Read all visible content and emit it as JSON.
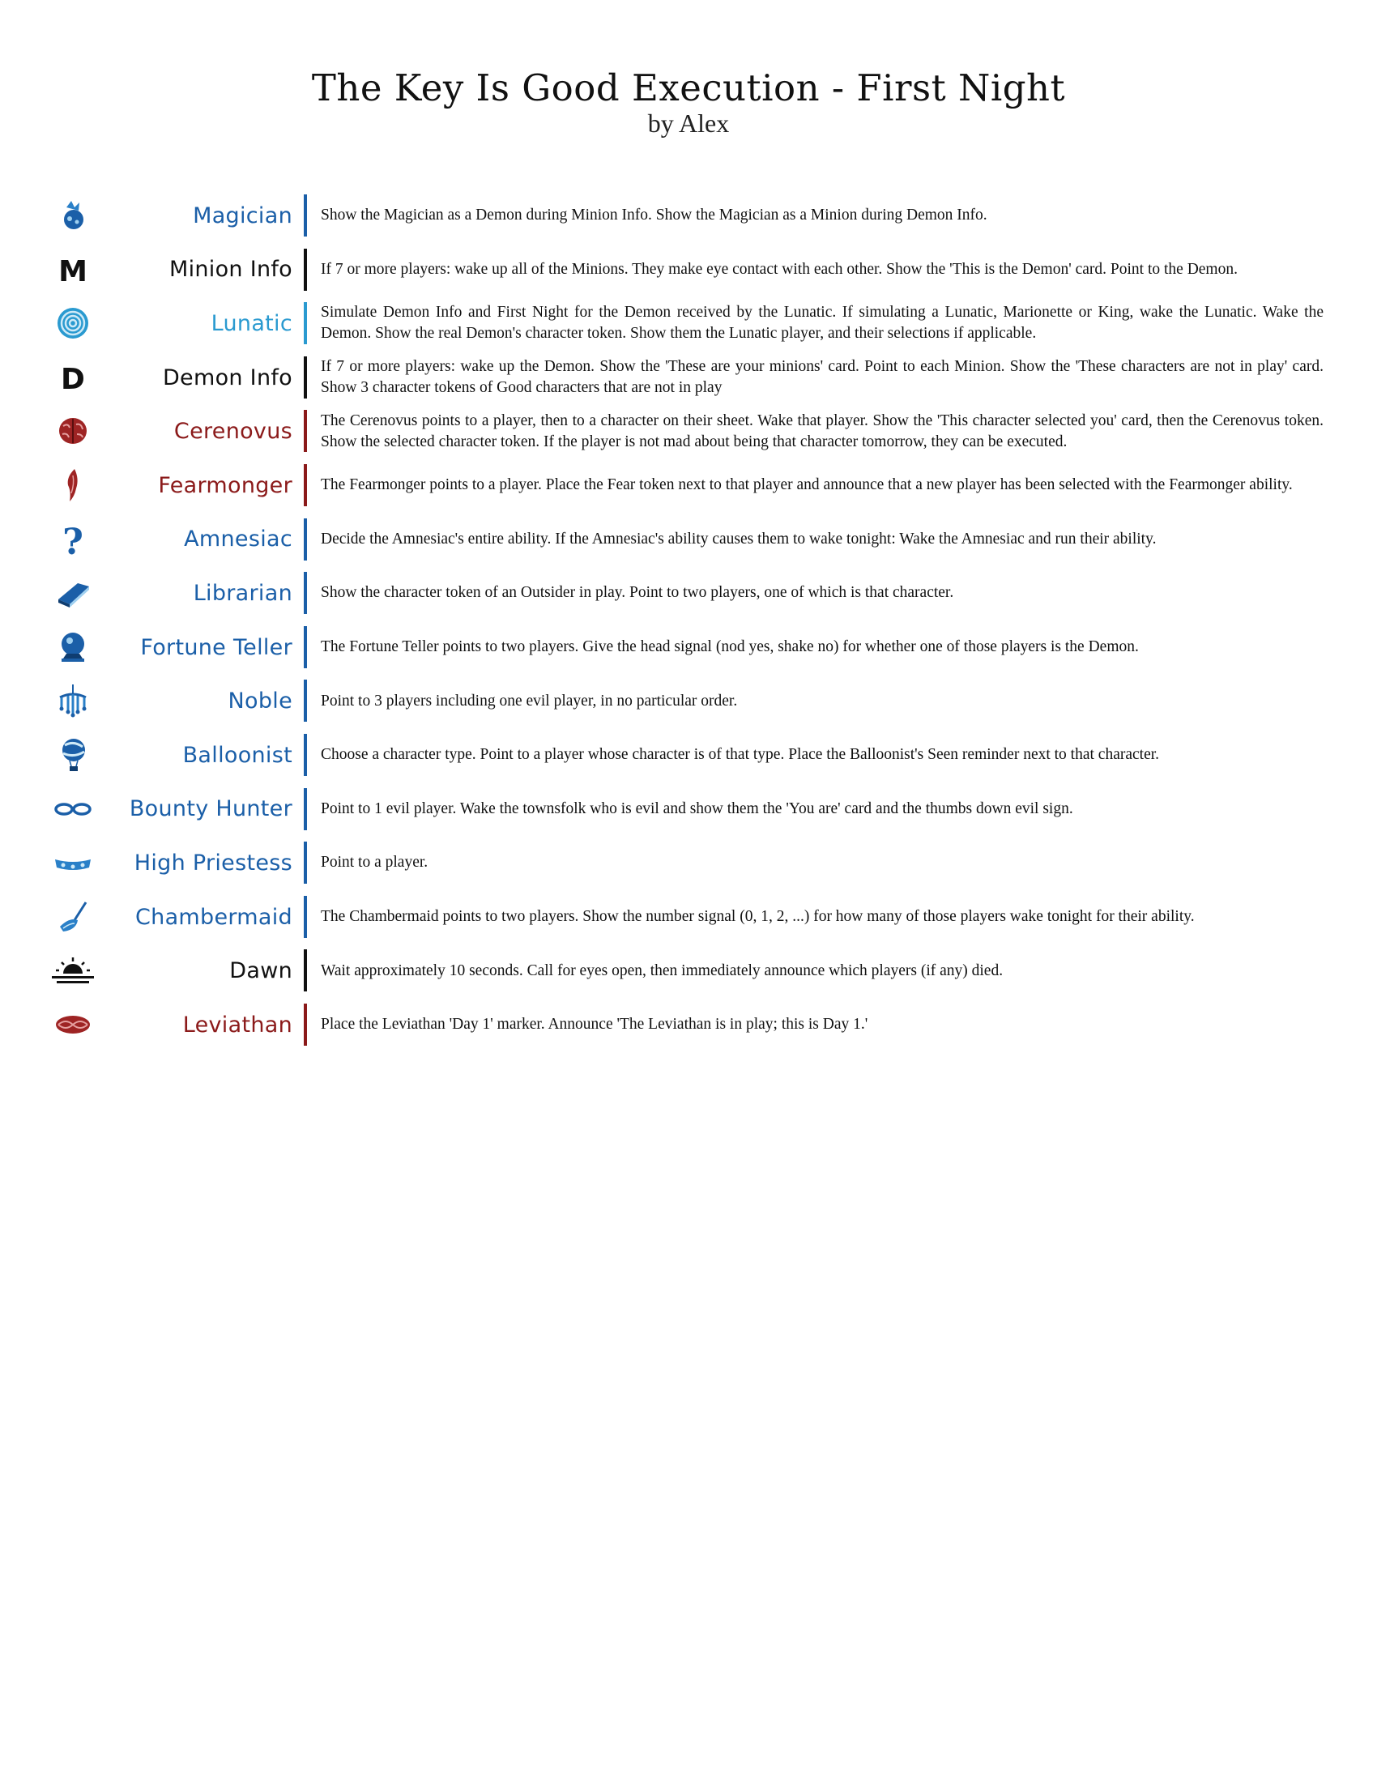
{
  "header": {
    "title": "The Key Is Good Execution - First Night",
    "subtitle": "by Alex"
  },
  "rows": [
    {
      "name": "Magician",
      "icon": "magician-icon",
      "team": "townsfolk",
      "text": "Show the Magician as a Demon during Minion Info. Show the Magician as a Minion during Demon Info."
    },
    {
      "name": "Minion Info",
      "icon": "minion-info-icon",
      "team": "info",
      "glyph": "M",
      "text": "If 7 or more players: wake up all of the Minions. They make eye contact with each other. Show the 'This is the Demon' card. Point to the Demon."
    },
    {
      "name": "Lunatic",
      "icon": "lunatic-icon",
      "team": "outsider",
      "text": "Simulate Demon Info and First Night for the Demon received by the Lunatic. If simulating a Lunatic, Marionette or King, wake the Lunatic. Wake the Demon. Show the real Demon's character token. Show them the Lunatic player, and their selections if applicable."
    },
    {
      "name": "Demon Info",
      "icon": "demon-info-icon",
      "team": "info",
      "glyph": "D",
      "text": "If 7 or more players: wake up the Demon. Show the 'These are your minions' card. Point to each Minion. Show the 'These characters are not in play' card. Show 3 character tokens of Good characters that are not in play"
    },
    {
      "name": "Cerenovus",
      "icon": "cerenovus-icon",
      "team": "minion",
      "text": "The Cerenovus points to a player, then to a character on their sheet. Wake that player. Show the 'This character selected you' card, then the Cerenovus token. Show the selected character token. If the player is not mad about being that character tomorrow, they can be executed."
    },
    {
      "name": "Fearmonger",
      "icon": "fearmonger-icon",
      "team": "minion",
      "text": "The Fearmonger points to a player. Place the Fear token next to that player and announce that a new player has been selected with the Fearmonger ability."
    },
    {
      "name": "Amnesiac",
      "icon": "amnesiac-icon",
      "team": "townsfolk",
      "text": "Decide the Amnesiac's entire ability. If the Amnesiac's ability causes them to wake tonight: Wake the Amnesiac and run their ability."
    },
    {
      "name": "Librarian",
      "icon": "librarian-icon",
      "team": "townsfolk",
      "text": "Show the character token of an Outsider in play. Point to two players, one of which is that character."
    },
    {
      "name": "Fortune Teller",
      "icon": "fortune-teller-icon",
      "team": "townsfolk",
      "text": "The Fortune Teller points to two players. Give the head signal (nod yes, shake no) for whether one of those players is the Demon."
    },
    {
      "name": "Noble",
      "icon": "noble-icon",
      "team": "townsfolk",
      "text": "Point to 3 players including one evil player, in no particular order."
    },
    {
      "name": "Balloonist",
      "icon": "balloonist-icon",
      "team": "townsfolk",
      "text": "Choose a character type. Point to a player whose character is of that type. Place the Balloonist's Seen reminder next to that character."
    },
    {
      "name": "Bounty Hunter",
      "icon": "bounty-hunter-icon",
      "team": "townsfolk",
      "text": "Point to 1 evil player. Wake the townsfolk who is evil and show them the 'You are' card and the thumbs down evil sign."
    },
    {
      "name": "High Priestess",
      "icon": "high-priestess-icon",
      "team": "townsfolk",
      "text": "Point to a player."
    },
    {
      "name": "Chambermaid",
      "icon": "chambermaid-icon",
      "team": "townsfolk",
      "text": "The Chambermaid points to two players. Show the number signal (0, 1, 2, ...) for how many of those players wake tonight for their ability."
    },
    {
      "name": "Dawn",
      "icon": "dawn-icon",
      "team": "info",
      "text": "Wait approximately 10 seconds. Call for eyes open, then immediately announce which players (if any) died."
    },
    {
      "name": "Leviathan",
      "icon": "leviathan-icon",
      "team": "minion",
      "text": "Place the Leviathan 'Day 1' marker. Announce 'The Leviathan is in play; this is Day 1.'"
    }
  ],
  "colors": {
    "townsfolk": "#1b5fa8",
    "outsider": "#2a9ad0",
    "minion": "#8b1a1a",
    "info": "#111111"
  }
}
